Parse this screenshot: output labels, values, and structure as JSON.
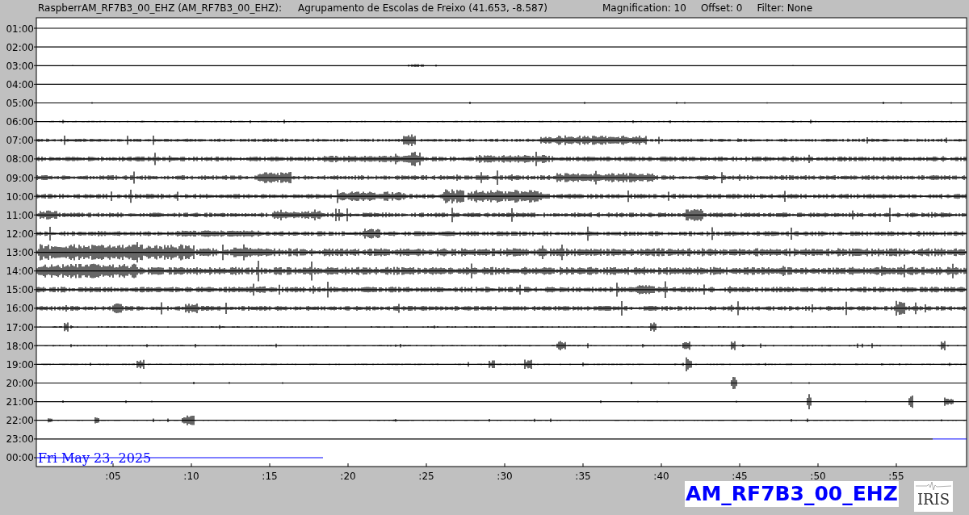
{
  "header": {
    "station": "RaspberrAM_RF7B3_00_EHZ (AM_RF7B3_00_EHZ):",
    "location": "Agrupamento de Escolas de Freixo (41.653, -8.587)",
    "magnification": "Magnification: 10",
    "offset": "Offset: 0",
    "filter": "Filter: None"
  },
  "plot": {
    "hour_labels": [
      "01:00",
      "02:00",
      "03:00",
      "04:00",
      "05:00",
      "06:00",
      "07:00",
      "08:00",
      "09:00",
      "10:00",
      "11:00",
      "12:00",
      "13:00",
      "14:00",
      "15:00",
      "16:00",
      "17:00",
      "18:00",
      "19:00",
      "20:00",
      "21:00",
      "22:00",
      "23:00",
      "00:00"
    ],
    "minute_labels": [
      ":05",
      ":10",
      ":15",
      ":20",
      ":25",
      ":30",
      ":35",
      ":40",
      ":45",
      ":50",
      ":55"
    ],
    "date": "Fri May 23, 2025"
  },
  "channel_label": "AM_RF7B3_00_EHZ",
  "logo": "IRIS"
}
